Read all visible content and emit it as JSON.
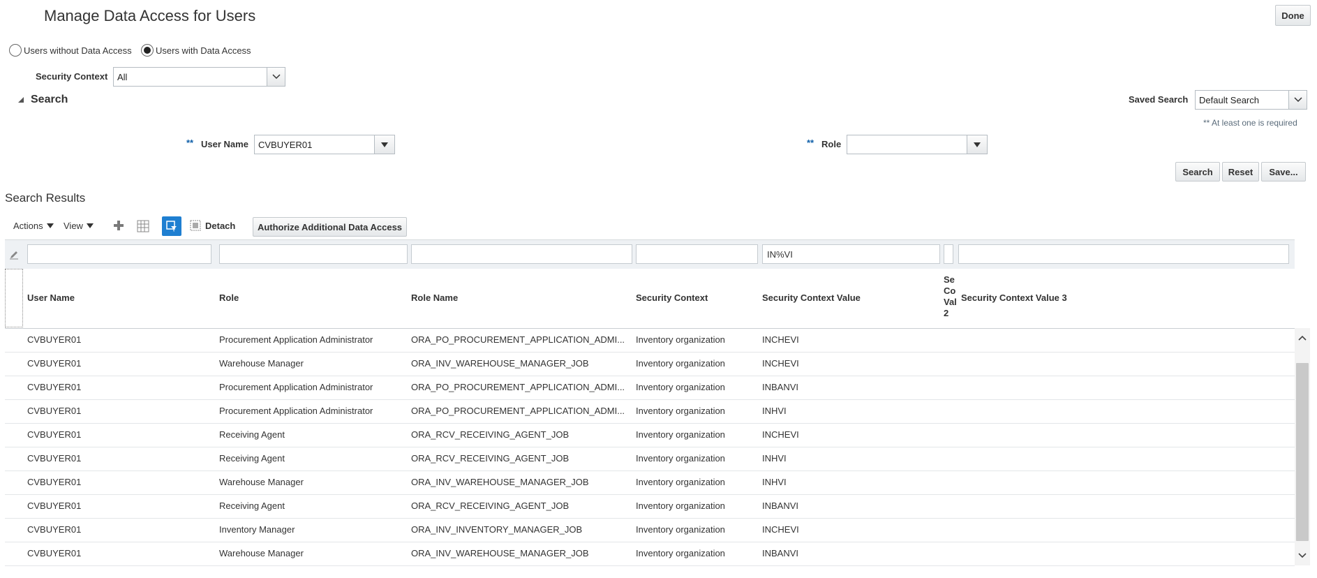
{
  "page": {
    "title": "Manage Data Access for Users",
    "done_label": "Done"
  },
  "filter": {
    "radio_without": "Users without Data Access",
    "radio_with": "Users with Data Access",
    "selected": "with",
    "security_context_label": "Security Context",
    "security_context_value": "All"
  },
  "search": {
    "section_label": "Search",
    "saved_search_label": "Saved Search",
    "saved_search_value": "Default Search",
    "required_note": "** At least one is required",
    "required_marker": "**",
    "user_name_label": "User Name",
    "user_name_value": "CVBUYER01",
    "role_label": "Role",
    "role_value": "",
    "search_button": "Search",
    "reset_button": "Reset",
    "save_button": "Save..."
  },
  "results": {
    "title": "Search Results",
    "toolbar": {
      "actions": "Actions",
      "view": "View",
      "detach": "Detach",
      "authorize": "Authorize Additional Data Access"
    },
    "filters": [
      "",
      "",
      "",
      "",
      "IN%VI",
      "",
      ""
    ],
    "columns": {
      "user_name": "User Name",
      "role": "Role",
      "role_name": "Role Name",
      "security_context": "Security Context",
      "security_context_value": "Security Context Value",
      "security_context_value_2_l1": "Se",
      "security_context_value_2_l2": "Co",
      "security_context_value_2_l3": "Val",
      "security_context_value_2_l4": "2",
      "security_context_value_3": "Security Context Value 3"
    },
    "rows": [
      {
        "user": "CVBUYER01",
        "role": "Procurement Application Administrator",
        "role_name": "ORA_PO_PROCUREMENT_APPLICATION_ADMI...",
        "context": "Inventory organization",
        "value": "INCHEVI"
      },
      {
        "user": "CVBUYER01",
        "role": "Warehouse Manager",
        "role_name": "ORA_INV_WAREHOUSE_MANAGER_JOB",
        "context": "Inventory organization",
        "value": "INCHEVI"
      },
      {
        "user": "CVBUYER01",
        "role": "Procurement Application Administrator",
        "role_name": "ORA_PO_PROCUREMENT_APPLICATION_ADMI...",
        "context": "Inventory organization",
        "value": "INBANVI"
      },
      {
        "user": "CVBUYER01",
        "role": "Procurement Application Administrator",
        "role_name": "ORA_PO_PROCUREMENT_APPLICATION_ADMI...",
        "context": "Inventory organization",
        "value": "INHVI"
      },
      {
        "user": "CVBUYER01",
        "role": "Receiving Agent",
        "role_name": "ORA_RCV_RECEIVING_AGENT_JOB",
        "context": "Inventory organization",
        "value": "INCHEVI"
      },
      {
        "user": "CVBUYER01",
        "role": "Receiving Agent",
        "role_name": "ORA_RCV_RECEIVING_AGENT_JOB",
        "context": "Inventory organization",
        "value": "INHVI"
      },
      {
        "user": "CVBUYER01",
        "role": "Warehouse Manager",
        "role_name": "ORA_INV_WAREHOUSE_MANAGER_JOB",
        "context": "Inventory organization",
        "value": "INHVI"
      },
      {
        "user": "CVBUYER01",
        "role": "Receiving Agent",
        "role_name": "ORA_RCV_RECEIVING_AGENT_JOB",
        "context": "Inventory organization",
        "value": "INBANVI"
      },
      {
        "user": "CVBUYER01",
        "role": "Inventory Manager",
        "role_name": "ORA_INV_INVENTORY_MANAGER_JOB",
        "context": "Inventory organization",
        "value": "INCHEVI"
      },
      {
        "user": "CVBUYER01",
        "role": "Warehouse Manager",
        "role_name": "ORA_INV_WAREHOUSE_MANAGER_JOB",
        "context": "Inventory organization",
        "value": "INBANVI"
      }
    ]
  },
  "icons": {
    "add": "plus-icon",
    "freeze": "freeze-columns-icon",
    "query_by_example": "filter-icon",
    "detach": "detach-icon",
    "edit": "pencil-icon"
  },
  "colors": {
    "accent": "#1f7fd1",
    "required": "#0f5fa8",
    "filter_row_bg": "#eef1f4"
  }
}
